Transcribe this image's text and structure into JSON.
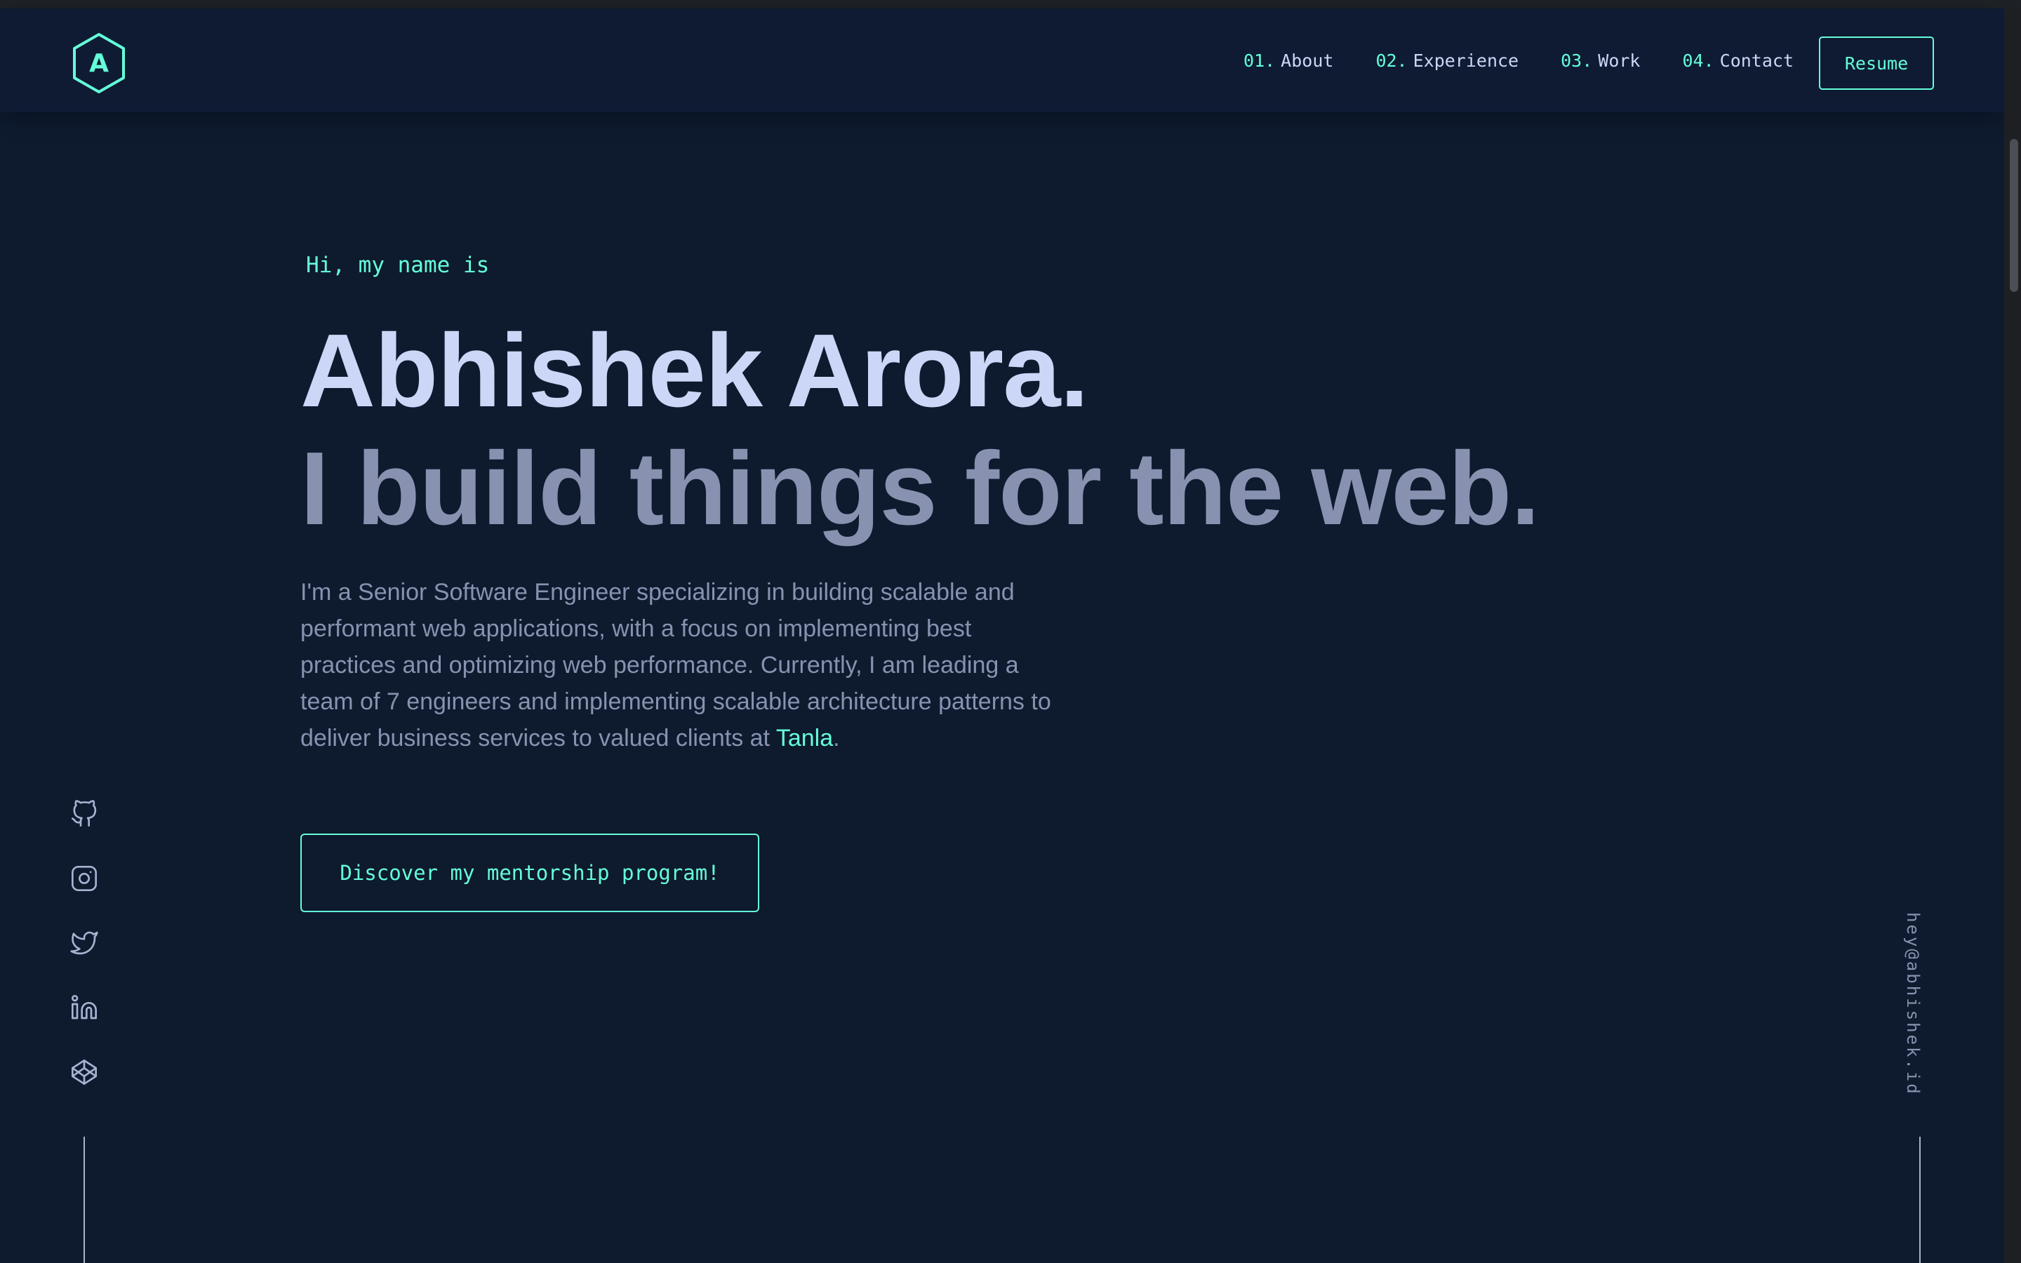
{
  "header": {
    "logo_letter": "A",
    "nav": [
      {
        "num": "01.",
        "label": "About"
      },
      {
        "num": "02.",
        "label": "Experience"
      },
      {
        "num": "03.",
        "label": "Work"
      },
      {
        "num": "04.",
        "label": "Contact"
      }
    ],
    "resume_label": "Resume"
  },
  "hero": {
    "greeting": "Hi, my name is",
    "name": "Abhishek Arora.",
    "tagline": "I build things for the web.",
    "bio_text": "I'm a Senior Software Engineer specializing in building scalable and performant web applications, with a focus on implementing best practices and optimizing web performance. Currently, I am leading a team of 7 engineers and implementing scalable architecture patterns to deliver business services to valued clients at ",
    "bio_link": "Tanla",
    "bio_end": ".",
    "cta_label": "Discover my mentorship program!"
  },
  "social": [
    "github-icon",
    "instagram-icon",
    "twitter-icon",
    "linkedin-icon",
    "codepen-icon"
  ],
  "email": "hey@abhishek.id",
  "colors": {
    "background": "#0e1a2e",
    "accent": "#64ffda",
    "heading": "#ccd6f6",
    "muted": "#8892b0"
  }
}
